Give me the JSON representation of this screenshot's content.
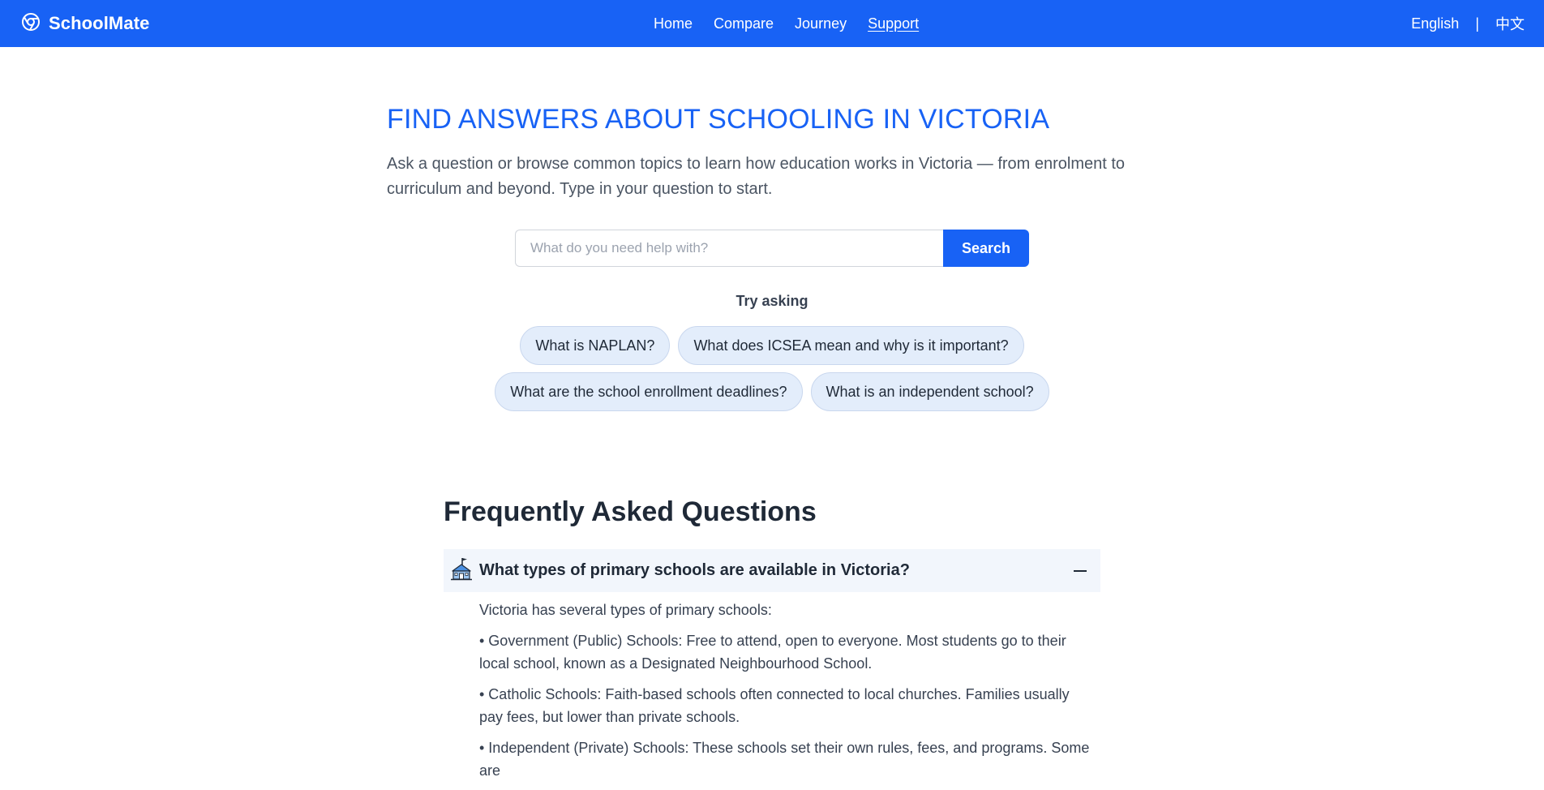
{
  "nav": {
    "brand": "SchoolMate",
    "links": [
      "Home",
      "Compare",
      "Journey",
      "Support"
    ],
    "active": "Support",
    "lang_en": "English",
    "lang_sep": "|",
    "lang_zh": "中文"
  },
  "hero": {
    "title": "FIND ANSWERS ABOUT SCHOOLING IN VICTORIA",
    "description": "Ask a question or browse common topics to learn how education works in Victoria — from enrolment to curriculum and beyond. Type in your question to start."
  },
  "search": {
    "placeholder": "What do you need help with?",
    "value": "",
    "button": "Search"
  },
  "suggestions": {
    "label": "Try asking",
    "chips": [
      "What is NAPLAN?",
      "What does ICSEA mean and why is it important?",
      "What are the school enrollment deadlines?",
      "What is an independent school?"
    ]
  },
  "faq": {
    "title": "Frequently Asked Questions",
    "items": [
      {
        "icon": "school-building-icon",
        "question": "What types of primary schools are available in Victoria?",
        "expanded": true,
        "toggle_icon": "minus-icon",
        "answer": [
          "Victoria has several types of primary schools:",
          "• Government (Public) Schools: Free to attend, open to everyone. Most students go to their local school, known as a Designated Neighbourhood School.",
          "• Catholic Schools: Faith-based schools often connected to local churches. Families usually pay fees, but lower than private schools.",
          "• Independent (Private) Schools: These schools set their own rules, fees, and programs. Some are"
        ]
      }
    ]
  },
  "colors": {
    "primary": "#1862f5",
    "chip_bg": "#e3edfb",
    "faq_head_bg": "#f2f6fc",
    "text": "#1f2937"
  }
}
